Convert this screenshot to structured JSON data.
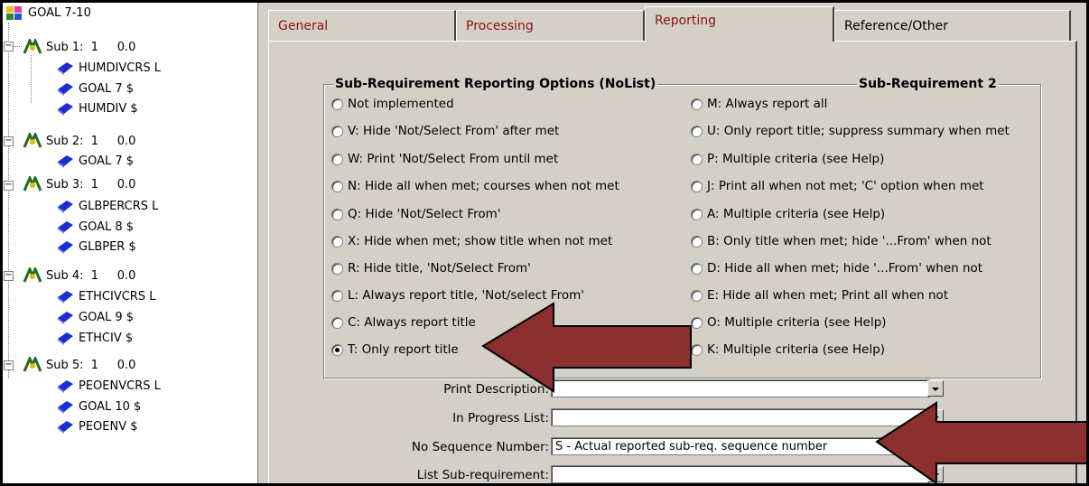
{
  "tree": {
    "root": "GOAL 7-10",
    "subs": [
      {
        "label": "Sub 1:  1     0.0",
        "children": [
          "HUMDIVCRS L",
          "GOAL 7 $",
          "HUMDIV $"
        ]
      },
      {
        "label": "Sub 2:  1     0.0",
        "children": [
          "GOAL 7 $"
        ]
      },
      {
        "label": "Sub 3:  1     0.0",
        "children": [
          "GLBPERCRS L",
          "GOAL 8 $",
          "GLBPER $"
        ]
      },
      {
        "label": "Sub 4:  1     0.0",
        "children": [
          "ETHCIVCRS L",
          "GOAL 9 $",
          "ETHCIV $"
        ]
      },
      {
        "label": "Sub 5:  1     0.0",
        "children": [
          "PEOENVCRS L",
          "GOAL 10 $",
          "PEOENV $"
        ]
      }
    ]
  },
  "tabs": [
    "General",
    "Processing",
    "Reporting",
    "Reference/Other"
  ],
  "active_tab": "Reporting",
  "group": {
    "title": "Sub-Requirement Reporting Options (NoList)",
    "title2": "Sub-Requirement 2",
    "left_options": [
      "Not implemented",
      "V: Hide 'Not/Select From' after met",
      "W: Print 'Not/Select From until met",
      "N: Hide all when met; courses when not met",
      "Q: Hide 'Not/Select From'",
      "X: Hide when met; show title when not met",
      "R: Hide title, 'Not/Select From'",
      "L: Always report title, 'Not/select From'",
      "C: Always report title",
      "T: Only report title"
    ],
    "right_options": [
      "M: Always report all",
      "U: Only report title; suppress summary when met",
      "P: Multiple criteria (see Help)",
      "J: Print all when not met; 'C' option when met",
      "A: Multiple criteria (see Help)",
      "B: Only title when met; hide '...From' when not",
      "D: Hide all when met; hide '...From' when not",
      "E: Hide all when met; Print all when not",
      "O: Multiple criteria (see Help)",
      "K: Multiple criteria (see Help)"
    ],
    "selected": "T: Only report title"
  },
  "fields": {
    "print_description": {
      "label": "Print Description:",
      "value": ""
    },
    "in_progress_list": {
      "label": "In Progress List:",
      "value": ""
    },
    "no_sequence_number": {
      "label": "No Sequence Number:",
      "value": "S - Actual reported sub-req. sequence number"
    },
    "list_sub_requirement": {
      "label": "List Sub-requirement:",
      "value": ""
    }
  },
  "colors": {
    "arrow": "#8b2f2f",
    "panel": "#d4d0c8",
    "tab_text": "#8b1111",
    "book_icon": "#1a2fd0"
  }
}
